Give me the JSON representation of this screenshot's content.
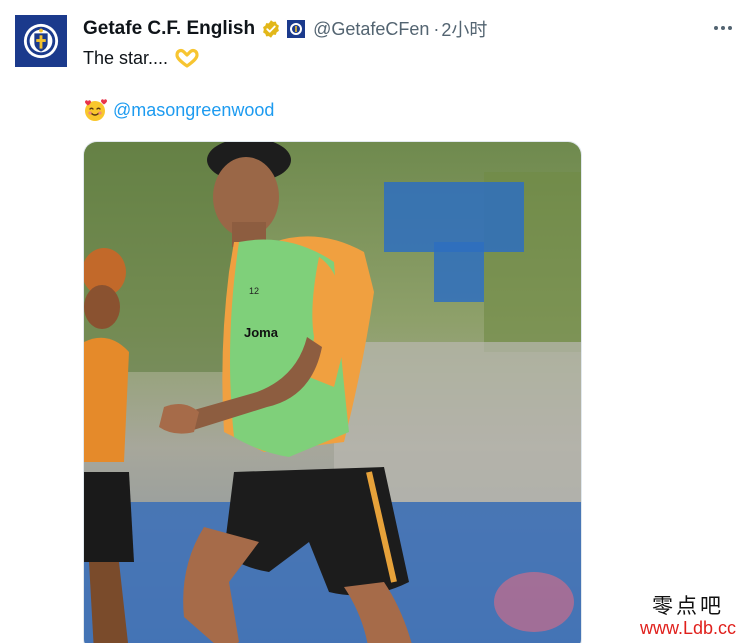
{
  "tweet": {
    "display_name": "Getafe C.F. English",
    "handle": "@GetafeCFen",
    "separator": "·",
    "time": "2小时",
    "text": "The star....",
    "mention": "@masongreenwood"
  },
  "icons": {
    "avatar": "getafe-crest-icon",
    "verified": "gold-verified-check-icon",
    "affiliate": "getafe-affiliate-badge-icon",
    "emoji_1": "heart-hands-emoji",
    "emoji_2": "smiling-face-with-hearts-emoji",
    "more": "more-options-icon"
  },
  "media": {
    "jersey_logo": "Joma",
    "jersey_number": "12"
  },
  "watermark": {
    "line1": "零点吧",
    "line2": "www.Ldb.cc"
  },
  "colors": {
    "link": "#1d9bf0",
    "secondary_text": "#536471",
    "verified_gold": "#e2b719",
    "brand_blue": "#1b3a8c",
    "watermark_red": "#e0201c"
  }
}
